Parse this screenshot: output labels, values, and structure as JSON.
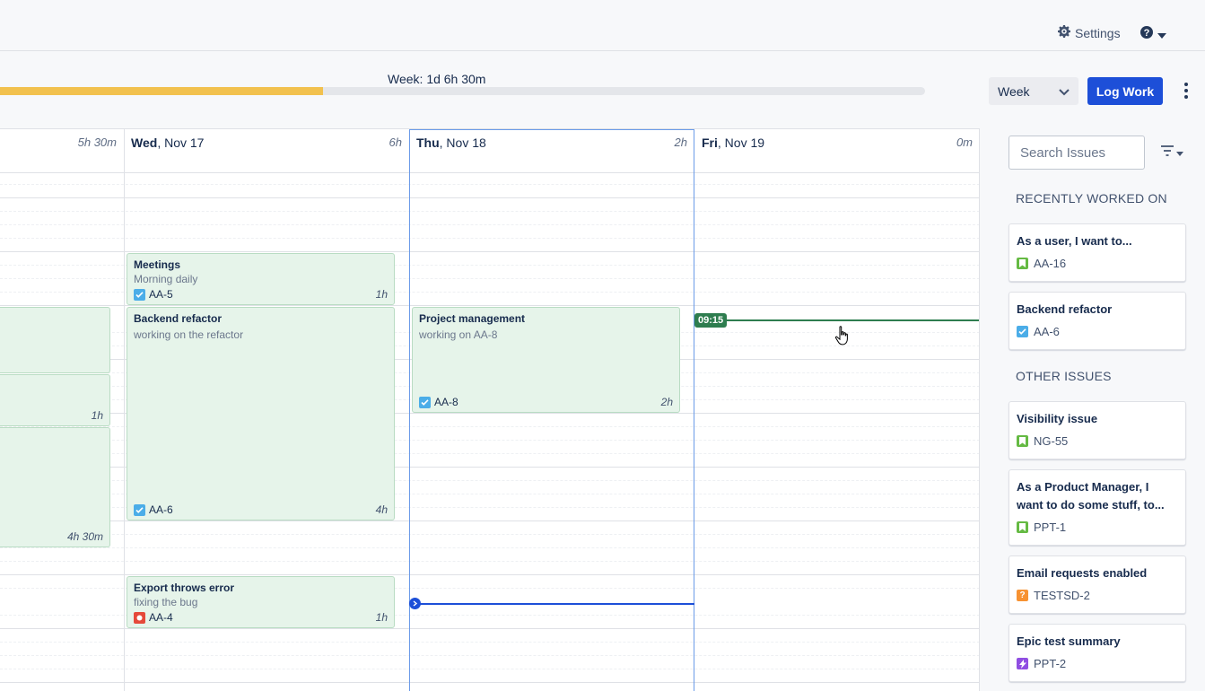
{
  "header": {
    "settings_label": "Settings"
  },
  "progress": {
    "label": "Week: 1d 6h 30m",
    "fraction": 0.349
  },
  "toolbar": {
    "view_value": "Week",
    "log_work_label": "Log Work"
  },
  "calendar": {
    "days": [
      {
        "weekday": "",
        "date": "",
        "total": "5h 30m"
      },
      {
        "weekday": "Wed",
        "date": ", Nov 17",
        "total": "6h"
      },
      {
        "weekday": "Thu",
        "date": ", Nov 18",
        "total": "2h"
      },
      {
        "weekday": "Fri",
        "date": ", Nov 19",
        "total": "0m"
      }
    ],
    "events": [
      {
        "title": "",
        "desc": "",
        "key": "",
        "duration": "1h"
      },
      {
        "title": "",
        "desc": "",
        "key": "",
        "duration": "4h 30m"
      },
      {
        "title": "Meetings",
        "desc": "Morning daily",
        "key": "AA-5",
        "duration": "1h"
      },
      {
        "title": "Backend refactor",
        "desc": "working on the refactor",
        "key": "AA-6",
        "duration": "4h"
      },
      {
        "title": "Export throws error",
        "desc": "fixing the bug",
        "key": "AA-4",
        "duration": "1h"
      },
      {
        "title": "Project management",
        "desc": "working on AA-8",
        "key": "AA-8",
        "duration": "2h"
      }
    ],
    "now_time": "09:15"
  },
  "sidebar": {
    "search_placeholder": "Search Issues",
    "recent_title": "RECENTLY WORKED ON",
    "other_title": "OTHER ISSUES",
    "recent": [
      {
        "title": "As a user, I want to...",
        "key": "AA-16",
        "icon": "story-icon"
      },
      {
        "title": "Backend refactor",
        "key": "AA-6",
        "icon": "task-icon"
      }
    ],
    "other": [
      {
        "title": "Visibility issue",
        "key": "NG-55",
        "icon": "story-icon"
      },
      {
        "title": "As a Product Manager, I want to do some stuff, to...",
        "key": "PPT-1",
        "icon": "story-icon"
      },
      {
        "title": "Email requests enabled",
        "key": "TESTSD-2",
        "icon": "question-icon"
      },
      {
        "title": "Epic test summary",
        "key": "PPT-2",
        "icon": "epic-icon"
      }
    ]
  },
  "colors": {
    "primary": "#1d4fd8",
    "progress": "#f2c14e",
    "event_bg": "#e6f4ea",
    "now_marker": "#2e7d4f"
  }
}
